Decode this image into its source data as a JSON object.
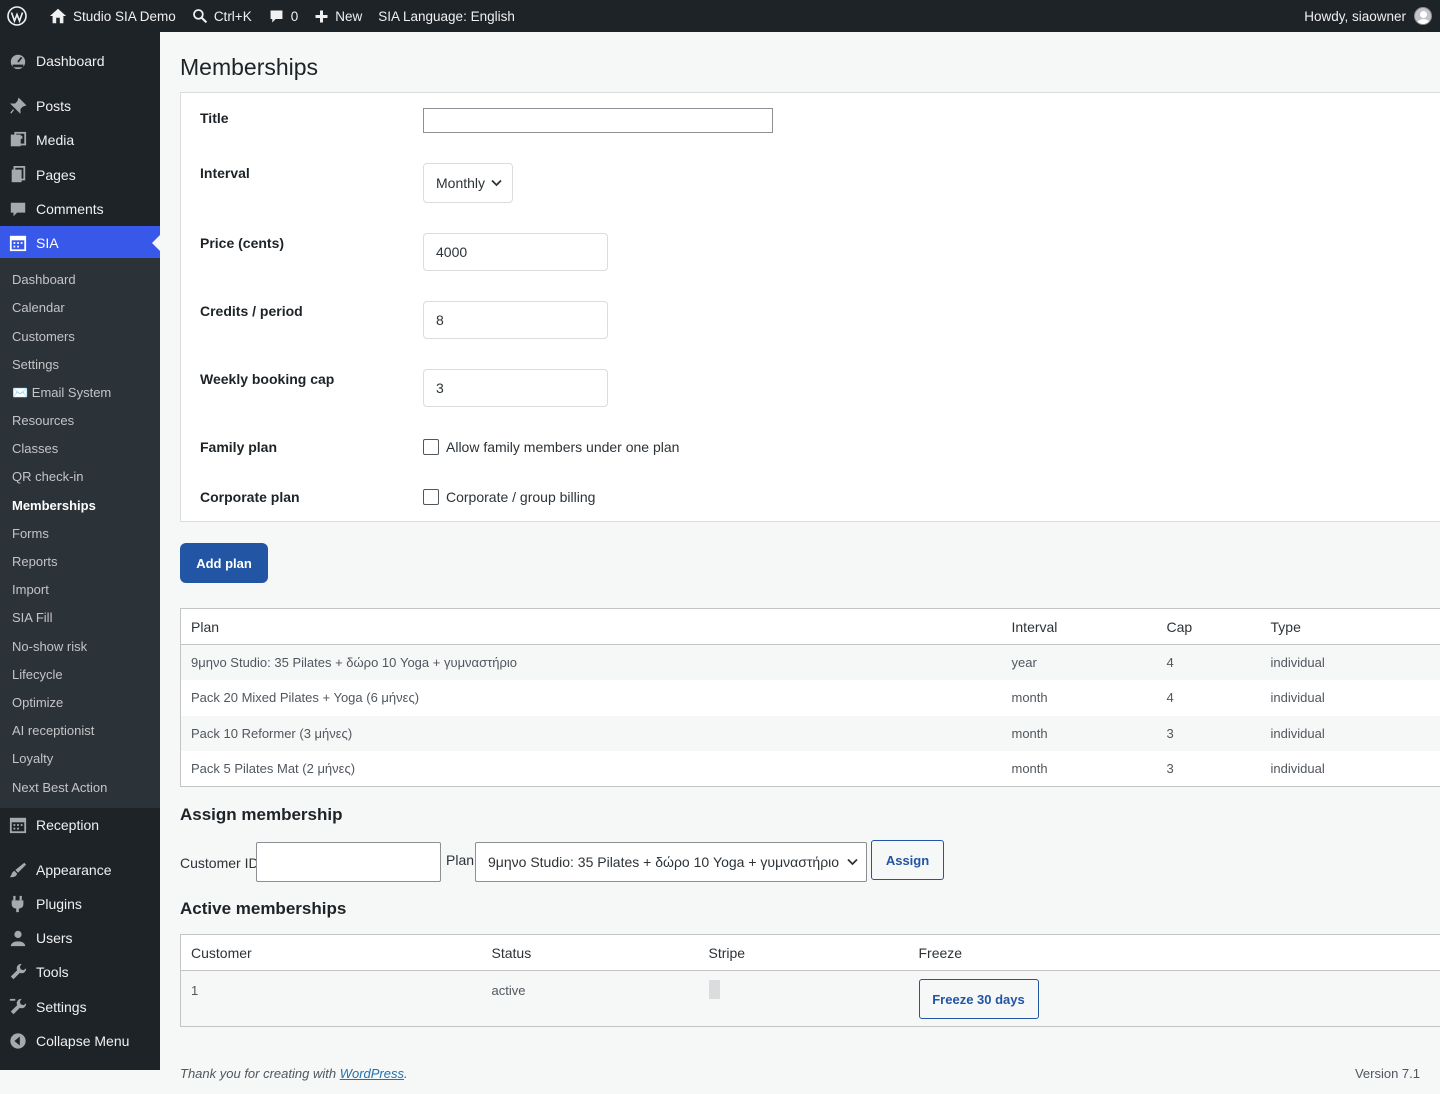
{
  "adminbar": {
    "site_name": "Studio SIA Demo",
    "search_shortcut": "Ctrl+K",
    "comments_count": "0",
    "new_label": "New",
    "language": "SIA Language: English",
    "howdy": "Howdy, siaowner"
  },
  "sidebar": {
    "dashboard": "Dashboard",
    "posts": "Posts",
    "media": "Media",
    "pages": "Pages",
    "comments": "Comments",
    "sia": "SIA",
    "submenu": [
      "Dashboard",
      "Calendar",
      "Customers",
      "Settings",
      "✉️ Email System",
      "Resources",
      "Classes",
      "QR check-in",
      "Memberships",
      "Forms",
      "Reports",
      "Import",
      "SIA Fill",
      "No-show risk",
      "Lifecycle",
      "Optimize",
      "AI receptionist",
      "Loyalty",
      "Next Best Action"
    ],
    "reception": "Reception",
    "appearance": "Appearance",
    "plugins": "Plugins",
    "users": "Users",
    "tools": "Tools",
    "settings": "Settings",
    "collapse": "Collapse Menu"
  },
  "page": {
    "title": "Memberships"
  },
  "form": {
    "title_label": "Title",
    "title_value": "",
    "interval_label": "Interval",
    "interval_value": "Monthly",
    "price_label": "Price (cents)",
    "price_value": "4000",
    "credits_label": "Credits / period",
    "credits_value": "8",
    "cap_label": "Weekly booking cap",
    "cap_value": "3",
    "family_label": "Family plan",
    "family_option": "Allow family members under one plan",
    "corporate_label": "Corporate plan",
    "corporate_option": "Corporate / group billing",
    "add_button": "Add plan"
  },
  "plans_table": {
    "headers": [
      "Plan",
      "Interval",
      "Cap",
      "Type"
    ],
    "rows": [
      [
        "9μηνο Studio: 35 Pilates + δώρο 10 Yoga + γυμναστήριο",
        "year",
        "4",
        "individual"
      ],
      [
        "Pack 20 Mixed Pilates + Yoga (6 μήνες)",
        "month",
        "4",
        "individual"
      ],
      [
        "Pack 10 Reformer (3 μήνες)",
        "month",
        "3",
        "individual"
      ],
      [
        "Pack 5 Pilates Mat (2 μήνες)",
        "month",
        "3",
        "individual"
      ]
    ]
  },
  "assign": {
    "heading": "Assign membership",
    "customer_label": "Customer ID",
    "customer_value": "",
    "plan_label": "Plan",
    "plan_value": "9μηνο Studio: 35 Pilates + δώρο 10 Yoga + γυμναστήριο",
    "button": "Assign"
  },
  "active": {
    "heading": "Active memberships",
    "headers": [
      "Customer",
      "Status",
      "Stripe",
      "Freeze"
    ],
    "rows": [
      {
        "customer": "1",
        "status": "active",
        "freeze_button": "Freeze 30 days"
      }
    ]
  },
  "footer": {
    "thanks_prefix": "Thank you for creating with ",
    "wordpress_link": "WordPress",
    "thanks_suffix": ".",
    "version": "Version 7.1"
  },
  "colors": {
    "admin_dark": "#1d2327",
    "accent": "#3858e9",
    "primary_button": "#2255a4"
  }
}
